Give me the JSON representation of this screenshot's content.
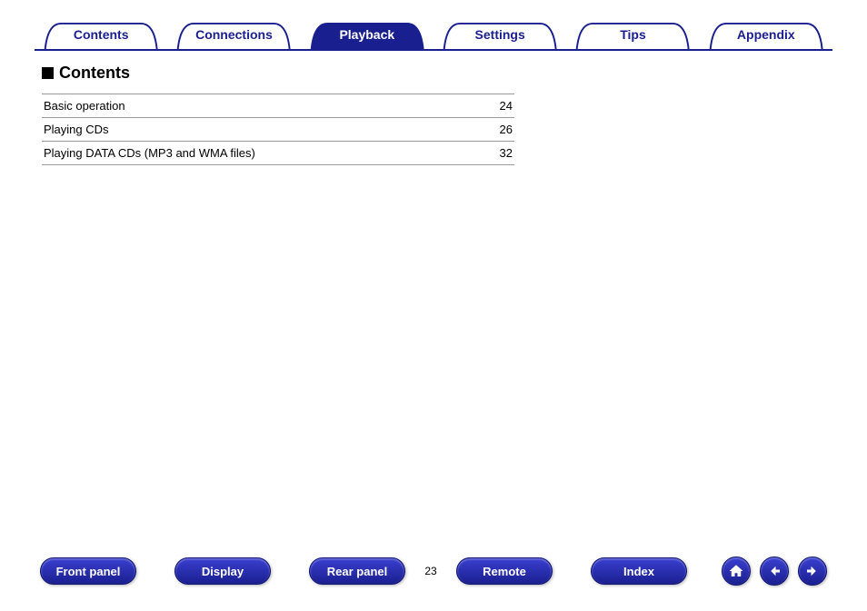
{
  "tabs": {
    "items": [
      {
        "label": "Contents",
        "active": false
      },
      {
        "label": "Connections",
        "active": false
      },
      {
        "label": "Playback",
        "active": true
      },
      {
        "label": "Settings",
        "active": false
      },
      {
        "label": "Tips",
        "active": false
      },
      {
        "label": "Appendix",
        "active": false
      }
    ]
  },
  "section": {
    "title": "Contents"
  },
  "toc": [
    {
      "title": "Basic operation",
      "page": "24"
    },
    {
      "title": "Playing CDs",
      "page": "26"
    },
    {
      "title": "Playing DATA CDs (MP3 and WMA files)",
      "page": "32"
    }
  ],
  "bottom": {
    "buttons": {
      "front_panel": "Front panel",
      "display": "Display",
      "rear_panel": "Rear panel",
      "remote": "Remote",
      "index": "Index"
    },
    "page_number": "23"
  }
}
